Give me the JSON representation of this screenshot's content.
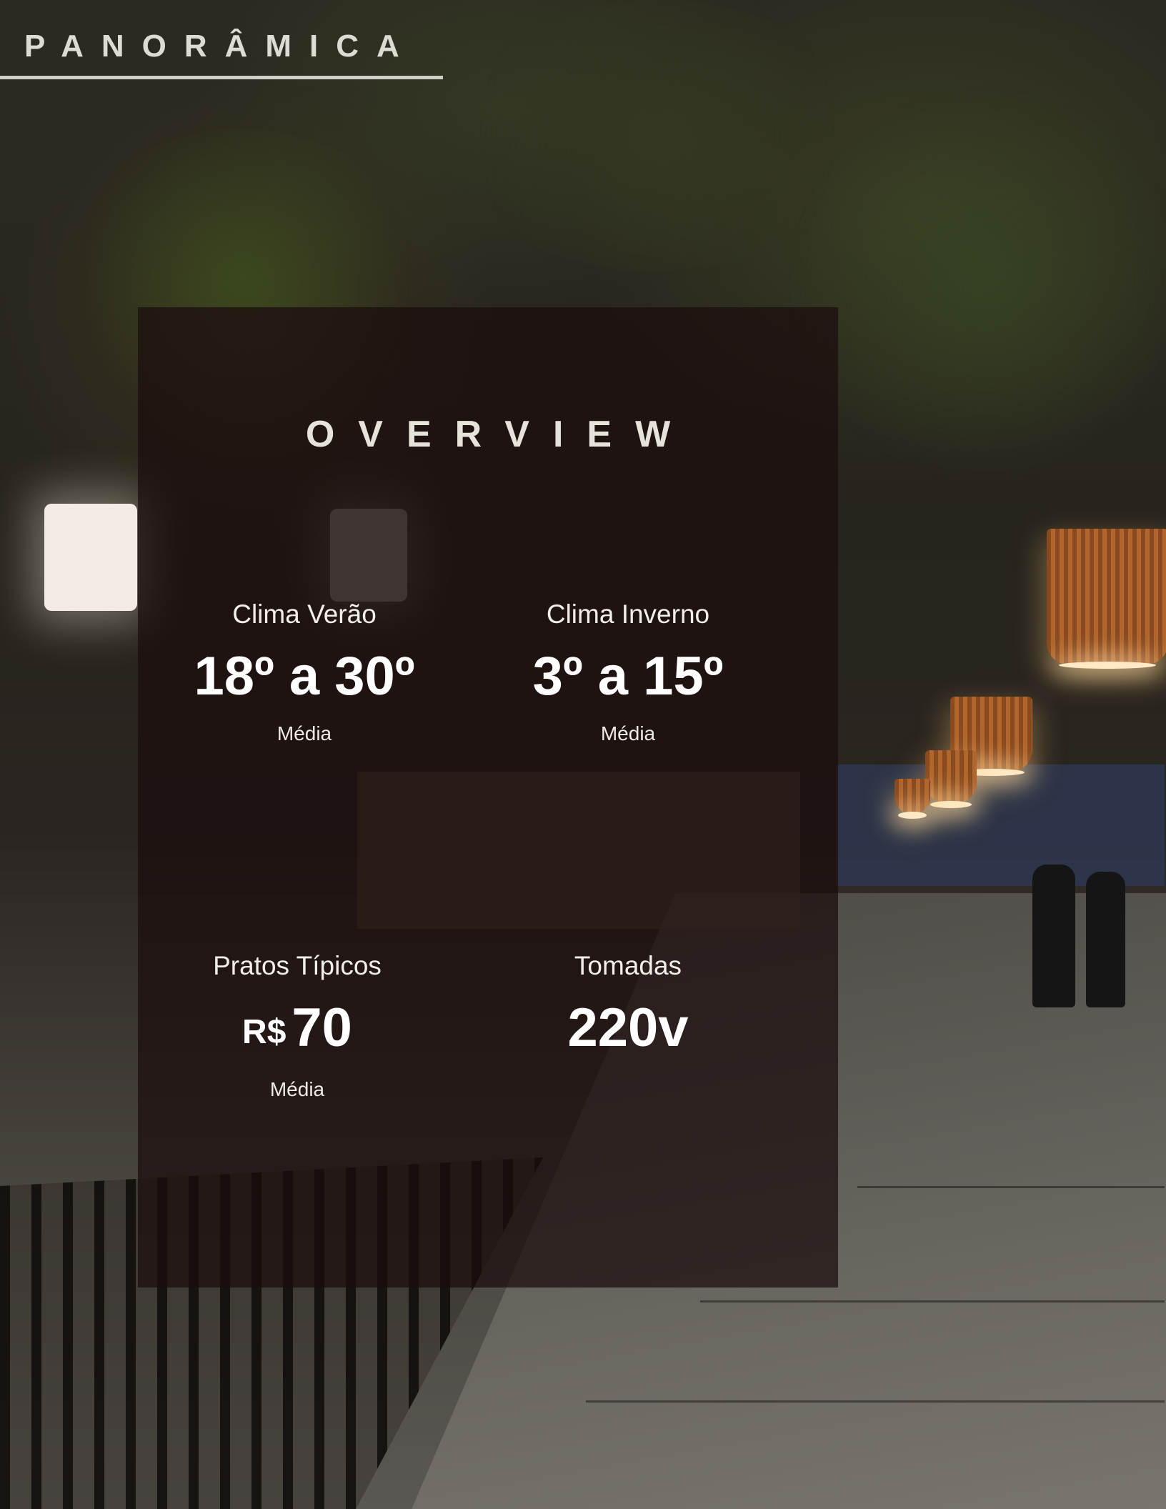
{
  "header": {
    "brand": "PANORÂMICA"
  },
  "overview": {
    "title": "OVERVIEW",
    "stats": [
      {
        "label": "Clima Verão",
        "value": "18º a 30º",
        "note": "Média"
      },
      {
        "label": "Clima Inverno",
        "value": "3º a 15º",
        "note": "Média"
      },
      {
        "label": "Pratos Típicos",
        "currency": "R$",
        "value": "70",
        "note": "Média"
      },
      {
        "label": "Tomadas",
        "value": "220v"
      }
    ]
  },
  "colors": {
    "panel": "#1a0c0c",
    "text": "#ffffff",
    "brand": "#dcdcd2"
  }
}
